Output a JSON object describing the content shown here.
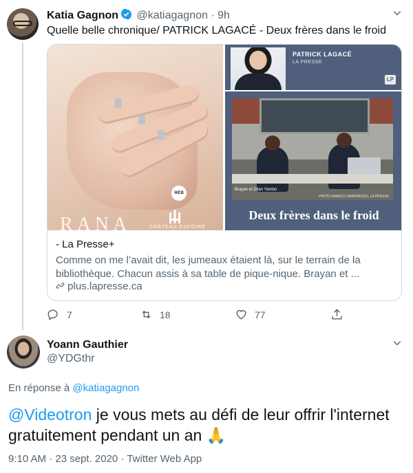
{
  "tweet1": {
    "author_name": "Katia Gagnon",
    "handle": "@katiagagnon",
    "sep": "·",
    "time": "9h",
    "text": "Quelle belle chronique/ PATRICK LAGACÉ - Deux frères dans le froid",
    "card": {
      "ad_text": "RANA",
      "ad_brand": "CHÂTEAU DUFOIRE",
      "ad_badge": "WEB",
      "columnist_name": "PATRICK LAGACÉ",
      "publication": "LA PRESSE",
      "photo_caption": "Brayan et Dilan Yambo",
      "photo_credit": "PHOTO MARCO CAMPANOZZI, LA PRESSE",
      "article_title": "Deux frères dans le froid",
      "domain_title": "- La Presse+",
      "description": "Comme on me l’avait dit, les jumeaux étaient là, sur le terrain de la bibliothèque. Chacun assis à sa table de pique-nique. Brayan et ...",
      "link": "plus.lapresse.ca"
    },
    "actions": {
      "replies": "7",
      "retweets": "18",
      "likes": "77"
    }
  },
  "tweet2": {
    "author_name": "Yoann Gauthier",
    "handle": "@YDGthr",
    "reply_prefix": "En réponse à",
    "reply_to": "@katiagagnon",
    "mention": "@Videotron",
    "text": " je vous mets au défi de leur offrir l'internet gratuitement pendant un an ",
    "emoji": "🙏",
    "timestamp": "9:10 AM · 23 sept. 2020 · Twitter Web App"
  },
  "colors": {
    "accent": "#1d9bf0",
    "muted": "#536471",
    "border": "#cfd9de",
    "header_blue": "#4f5f7c"
  },
  "icons": [
    "verified-badge-icon",
    "chevron-down-icon",
    "reply-icon",
    "retweet-icon",
    "like-icon",
    "share-icon",
    "link-icon"
  ]
}
